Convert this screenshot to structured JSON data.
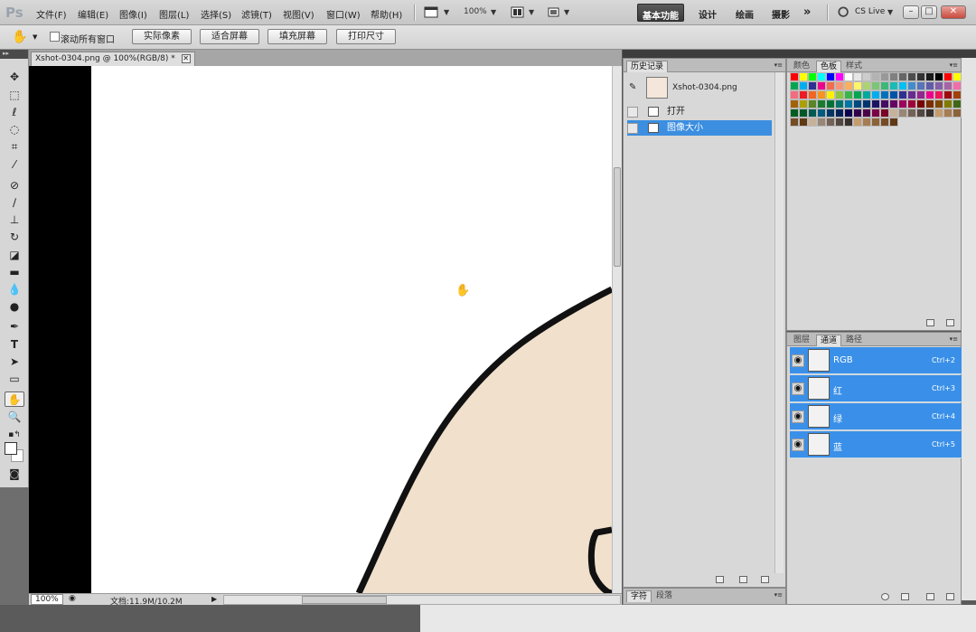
{
  "app": {
    "logo": "Ps"
  },
  "menu": [
    "文件(F)",
    "编辑(E)",
    "图像(I)",
    "图层(L)",
    "选择(S)",
    "滤镜(T)",
    "视图(V)",
    "窗口(W)",
    "帮助(H)"
  ],
  "appbar": {
    "zoom": "100%"
  },
  "workspaces": [
    "基本功能",
    "设计",
    "绘画",
    "摄影"
  ],
  "active_workspace": "基本功能",
  "cs_live": "CS Live",
  "options": {
    "scroll_all_label": "滚动所有窗口",
    "scroll_all_checked": false,
    "buttons": [
      "实际像素",
      "适合屏幕",
      "填充屏幕",
      "打印尺寸"
    ]
  },
  "document": {
    "tab_title": "Xshot-0304.png @ 100%(RGB/8) *",
    "zoom": "100%",
    "doc_size": "文档:11.9M/10.2M"
  },
  "history": {
    "tab": "历史记录",
    "snapshot": "Xshot-0304.png",
    "items": [
      {
        "label": "打开",
        "selected": false
      },
      {
        "label": "图像大小",
        "selected": true
      }
    ]
  },
  "swatch_panel": {
    "tabs": [
      "颜色",
      "色板",
      "样式"
    ],
    "active_tab": "色板"
  },
  "swatches": [
    "#ff0000",
    "#ffff00",
    "#00ff00",
    "#00ffff",
    "#0000ff",
    "#ff00ff",
    "#ffffff",
    "#e6e6e6",
    "#cccccc",
    "#b3b3b3",
    "#999999",
    "#808080",
    "#666666",
    "#4d4d4d",
    "#333333",
    "#1a1a1a",
    "#000000",
    "#ff0000",
    "#ffff00",
    "#00a651",
    "#00aeef",
    "#2e3192",
    "#ec008c",
    "#f26c4f",
    "#f69679",
    "#fbaf5d",
    "#fff568",
    "#acd373",
    "#7cc576",
    "#3bb878",
    "#1abbb4",
    "#00bff3",
    "#438ccb",
    "#5574b9",
    "#605ca8",
    "#855fa8",
    "#a763a8",
    "#f06ea9",
    "#f26d7d",
    "#ed1c24",
    "#f26522",
    "#f7941d",
    "#fff200",
    "#8dc63f",
    "#39b54a",
    "#00a651",
    "#00a99d",
    "#00aeef",
    "#0072bc",
    "#0054a6",
    "#2e3192",
    "#662d91",
    "#92278f",
    "#ec008c",
    "#ed145b",
    "#9e0b0f",
    "#a0410d",
    "#a3620a",
    "#aba000",
    "#598527",
    "#197b30",
    "#007236",
    "#00746b",
    "#0076a3",
    "#004a80",
    "#003471",
    "#1b1464",
    "#440e62",
    "#630460",
    "#9e005d",
    "#9e0039",
    "#790000",
    "#7b2e00",
    "#7d4900",
    "#827b00",
    "#406618",
    "#005e20",
    "#005826",
    "#005952",
    "#005b7f",
    "#003663",
    "#002157",
    "#0d004c",
    "#32004b",
    "#4b0049",
    "#7b0046",
    "#7a0026",
    "#c7b299",
    "#998675",
    "#736357",
    "#534741",
    "#37302d",
    "#c69c6d",
    "#a67c52",
    "#8c6239",
    "#754c24",
    "#603913",
    "#c7b299",
    "#998675",
    "#736357",
    "#534741",
    "#37302d",
    "#c69c6d",
    "#a67c52",
    "#8c6239",
    "#754c24",
    "#603913"
  ],
  "channels_panel": {
    "tabs": [
      "图层",
      "通道",
      "路径"
    ],
    "active_tab": "通道",
    "channels": [
      {
        "name": "RGB",
        "shortcut": "Ctrl+2"
      },
      {
        "name": "红",
        "shortcut": "Ctrl+3"
      },
      {
        "name": "绿",
        "shortcut": "Ctrl+4"
      },
      {
        "name": "蓝",
        "shortcut": "Ctrl+5"
      }
    ]
  },
  "type_panel": {
    "tabs": [
      "字符",
      "段落"
    ]
  },
  "icons": [
    "hand-icon",
    "move-icon",
    "marquee-icon",
    "lasso-icon",
    "quick-select-icon",
    "crop-icon",
    "eyedropper-icon",
    "healing-icon",
    "brush-icon",
    "stamp-icon",
    "history-brush-icon",
    "eraser-icon",
    "gradient-icon",
    "blur-icon",
    "dodge-icon",
    "pen-icon",
    "type-icon",
    "path-select-icon",
    "shape-icon",
    "zoom-icon",
    "eye-icon"
  ],
  "colors": {
    "selection": "#3a90e8",
    "skin": "#f0e0cc",
    "outline": "#111111"
  }
}
